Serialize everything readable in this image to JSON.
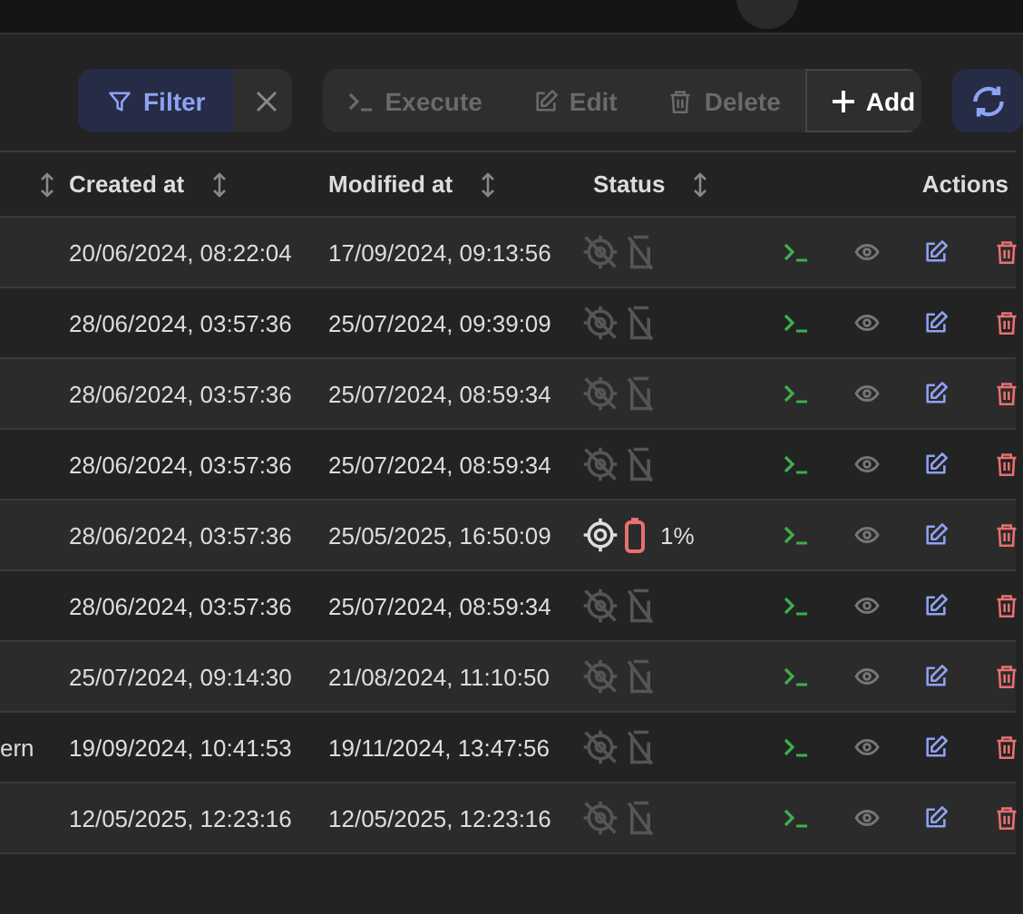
{
  "toolbar": {
    "filter": "Filter",
    "actions": [
      {
        "kind": "execute",
        "label": "Execute",
        "disabled": true
      },
      {
        "kind": "edit",
        "label": "Edit",
        "disabled": true
      },
      {
        "kind": "delete",
        "label": "Delete",
        "disabled": true
      },
      {
        "kind": "add",
        "label": "Add",
        "disabled": false
      }
    ]
  },
  "table": {
    "columns": [
      "Created at",
      "Modified at",
      "Status",
      "Actions"
    ],
    "rows": [
      {
        "column_1": "",
        "created": "20/06/2024, 08:22:04",
        "modified": "17/09/2024, 09:13:56",
        "online": false
      },
      {
        "column_1": "",
        "created": "28/06/2024, 03:57:36",
        "modified": "25/07/2024, 09:39:09",
        "online": false
      },
      {
        "column_1": "",
        "created": "28/06/2024, 03:57:36",
        "modified": "25/07/2024, 08:59:34",
        "online": false
      },
      {
        "column_1": "",
        "created": "28/06/2024, 03:57:36",
        "modified": "25/07/2024, 08:59:34",
        "online": false
      },
      {
        "column_1": "",
        "created": "28/06/2024, 03:57:36",
        "modified": "25/05/2025, 16:50:09",
        "online": true,
        "battery": "1%"
      },
      {
        "column_1": "",
        "created": "28/06/2024, 03:57:36",
        "modified": "25/07/2024, 08:59:34",
        "online": false
      },
      {
        "column_1": "",
        "created": "25/07/2024, 09:14:30",
        "modified": "21/08/2024, 11:10:50",
        "online": false
      },
      {
        "column_1": "ern",
        "created": "19/09/2024, 10:41:53",
        "modified": "19/11/2024, 13:47:56",
        "online": false
      },
      {
        "column_1": "",
        "created": "12/05/2025, 12:23:16",
        "modified": "12/05/2025, 12:23:16",
        "online": false
      }
    ]
  }
}
